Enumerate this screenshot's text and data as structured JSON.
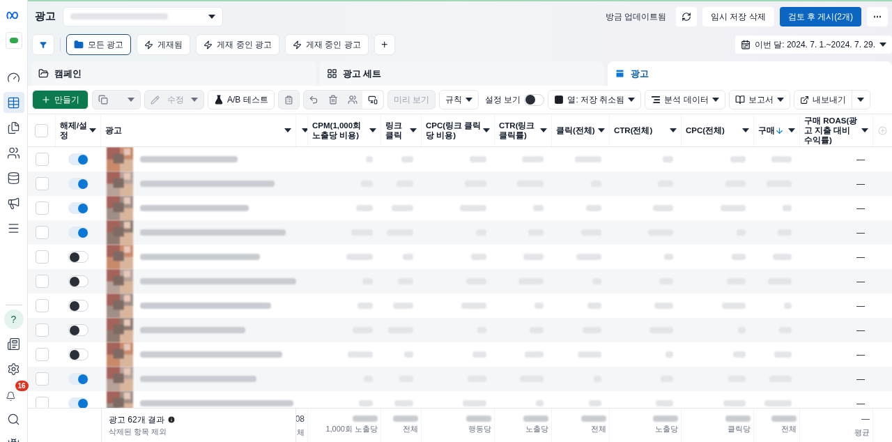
{
  "header": {
    "title": "광고",
    "status": "방금 업데이트됨",
    "discard": "임시 저장 삭제",
    "publish": "검토 후 게시(2개)",
    "more": "⋯"
  },
  "filters": [
    {
      "label": "모든 광고",
      "selected": true,
      "kind": "folder"
    },
    {
      "label": "게재됨",
      "selected": false,
      "kind": "zap"
    },
    {
      "label": "게재 중인 광고",
      "selected": false,
      "kind": "zap"
    },
    {
      "label": "게재 중인 광고",
      "selected": false,
      "kind": "zap"
    }
  ],
  "add": "+",
  "date_range": "이번 달: 2024. 7. 1.~2024. 7. 29.",
  "tabs": [
    {
      "label": "캠페인",
      "selected": false
    },
    {
      "label": "광고 세트",
      "selected": false
    },
    {
      "label": "광고",
      "selected": true
    }
  ],
  "toolbar": {
    "create": "만들기",
    "edit": {
      "label": "수정",
      "disabled": true
    },
    "ab_test": "A/B 테스트",
    "preview": {
      "label": "미리 보기",
      "disabled": true
    },
    "rules": "규칙",
    "view_settings": {
      "label": "설정 보기",
      "on": false
    },
    "columns": "열: 저장 취소됨",
    "breakdown": "분석 데이터",
    "reports": "보고서",
    "export": "내보내기"
  },
  "table": {
    "select_all": {
      "checked": false
    },
    "columns": [
      {
        "label": "해제/설정",
        "sorted": false
      },
      {
        "label": "광고",
        "sorted": false
      },
      {
        "sorted": false
      },
      {
        "label": "CPM(1,000회 노출당 비용)",
        "sorted": false
      },
      {
        "label": "링크 클릭",
        "sorted": false
      },
      {
        "label": "CPC(링크 클릭당 비용)",
        "sorted": false
      },
      {
        "label": "CTR(링크 클릭률)",
        "sorted": false
      },
      {
        "label": "클릭(전체)",
        "sorted": false
      },
      {
        "label": "CTR(전체)",
        "sorted": false
      },
      {
        "label": "CPC(전체)",
        "sorted": false
      },
      {
        "label": "구매",
        "sorted": true
      },
      {
        "label": "구매 ROAS(광고 지출 대비 수익률)",
        "sorted": false
      }
    ],
    "rows": [
      {
        "checked": false,
        "on": true,
        "roas": "—"
      },
      {
        "checked": false,
        "on": true,
        "roas": "—"
      },
      {
        "checked": false,
        "on": true,
        "roas": "—"
      },
      {
        "checked": false,
        "on": true,
        "roas": "—"
      },
      {
        "checked": false,
        "on": false,
        "roas": "—"
      },
      {
        "checked": false,
        "on": false,
        "roas": "—"
      },
      {
        "checked": false,
        "on": false,
        "roas": "—"
      },
      {
        "checked": false,
        "on": false,
        "roas": "—"
      },
      {
        "checked": false,
        "on": false,
        "roas": "—"
      },
      {
        "checked": false,
        "on": true,
        "roas": "—"
      },
      {
        "checked": false,
        "on": true,
        "roas": "—"
      }
    ],
    "summary": {
      "title": "광고 62개 결과",
      "note": "삭제된 항목 제외"
    },
    "footer": [
      {
        "value": "08",
        "unit": "체"
      },
      {
        "unit": "1,000회 노출당"
      },
      {
        "unit": "전체"
      },
      {
        "unit": "행동당"
      },
      {
        "unit": "노출당"
      },
      {
        "unit": "전체"
      },
      {
        "unit": "노출당"
      },
      {
        "unit": "클릭당"
      },
      {
        "unit": "전체"
      },
      {
        "value": "—",
        "unit": "평균"
      }
    ]
  },
  "sidebar": {
    "help": "?",
    "notifications": "16"
  }
}
